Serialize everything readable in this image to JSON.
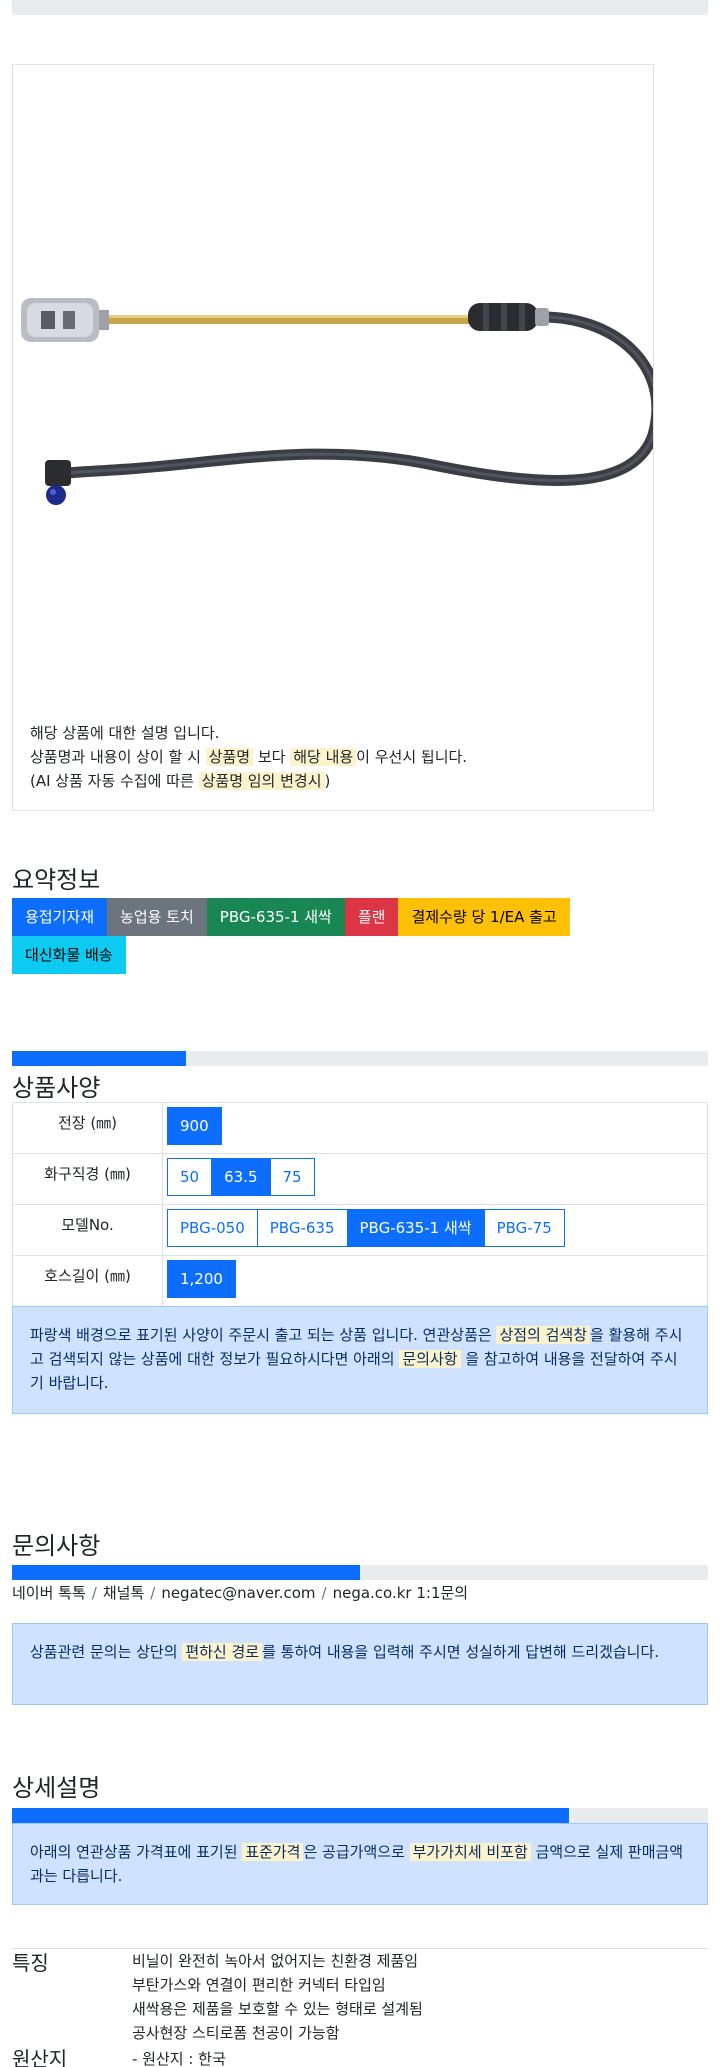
{
  "image_note": {
    "line1": "해당 상품에 대한 설명 입니다.",
    "line2_a": "상품명과 내용이 상이 할 시 ",
    "line2_mark1": "상품명",
    "line2_b": " 보다 ",
    "line2_mark2": "해당 내용",
    "line2_c": "이 우선시 됩니다.",
    "line3_a": "(AI 상품 자동 수집에 따른 ",
    "line3_mark": "상품명 임의 변경시",
    "line3_b": ")"
  },
  "summary": {
    "title": "요약정보",
    "badges": [
      {
        "label": "용접기자재",
        "color": "#0d6efd",
        "text_color": "#ffffff"
      },
      {
        "label": "농업용 토치",
        "color": "#6c757d",
        "text_color": "#ffffff"
      },
      {
        "label": "PBG-635-1 새싹",
        "color": "#198754",
        "text_color": "#ffffff"
      },
      {
        "label": "플랜",
        "color": "#dc3545",
        "text_color": "#ffffff"
      },
      {
        "label": "결제수량 당 1/EA 출고",
        "color": "#ffc107",
        "text_color": "#000000"
      },
      {
        "label": "대신화물 배송",
        "color": "#0dcaf0",
        "text_color": "#000000"
      }
    ]
  },
  "spec": {
    "title": "상품사양",
    "progress_fraction": 0.25,
    "rows": [
      {
        "label": "전장 (㎜)",
        "options": [
          "900"
        ],
        "selected": 0
      },
      {
        "label": "화구직경 (㎜)",
        "options": [
          "50",
          "63.5",
          "75"
        ],
        "selected": 1
      },
      {
        "label": "모델No.",
        "options": [
          "PBG-050",
          "PBG-635",
          "PBG-635-1 새싹",
          "PBG-75"
        ],
        "selected": 2
      },
      {
        "label": "호스길이 (㎜)",
        "options": [
          "1,200"
        ],
        "selected": 0
      }
    ],
    "notice_a": "파랑색 배경으로 표기된 사양이 주문시 출고 되는 상품 입니다. 연관상품은 ",
    "notice_mark1": "상점의 검색창",
    "notice_b": "을 활용해 주시고 검색되지 않는 상품에 대한 정보가 필요하시다면 아래의 ",
    "notice_mark2": "문의사항",
    "notice_c": " 을 참고하여 내용을 전달하여 주시기 바랍니다."
  },
  "inquiry": {
    "title": "문의사항",
    "progress_fraction": 0.5,
    "contacts": [
      "네이버 톡톡",
      "채널톡",
      "negatec@naver.com",
      "nega.co.kr 1:1문의"
    ],
    "separator": "/",
    "notice_a": "상품관련 문의는 상단의 ",
    "notice_mark": "편하신 경로",
    "notice_b": "를 통하여 내용을 입력해 주시면 성실하게 답변해 드리겠습니다."
  },
  "detail": {
    "title": "상세설명",
    "progress_fraction": 0.8,
    "notice_a": "아래의 연관상품 가격표에 표기된 ",
    "notice_mark1": "표준가격",
    "notice_b": "은 공급가액으로 ",
    "notice_mark2": "부가가치세 비포함",
    "notice_c": " 금액으로 실제 판매금액과는 다릅니다."
  },
  "features": {
    "label": "특징",
    "lines": [
      "비닐이 완전히 녹아서 없어지는 친환경 제품임",
      "부탄가스와 연결이 편리한 커넥터 타입임",
      "새싹용은 제품을 보호할 수 있는 형태로 설계됨",
      "공사현장 스티로폼 천공이 가능함"
    ],
    "origin_label": "원산지",
    "origin_value": "- 원산지 : 한국"
  },
  "colors": {
    "primary": "#0d6efd",
    "alert_bg": "#cfe2ff",
    "mark_bg": "#fcf3cc"
  }
}
